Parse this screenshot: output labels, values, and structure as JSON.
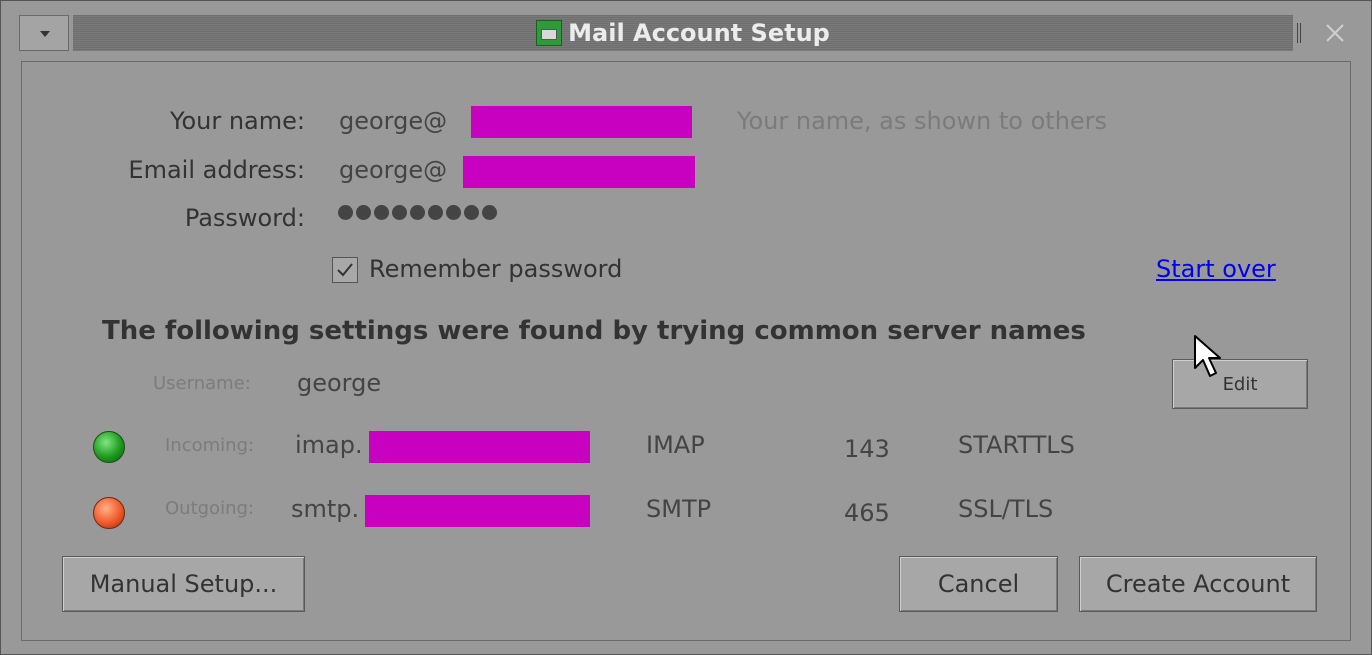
{
  "window": {
    "title": "Mail Account Setup",
    "icon": "mail-app-icon"
  },
  "form": {
    "name_label": "Your name:",
    "name_value": "george@",
    "name_hint": "Your name, as shown to others",
    "email_label": "Email address:",
    "email_value": "george@",
    "password_label": "Password:",
    "password_mask_count": 9,
    "remember_label": "Remember password",
    "remember_checked": true,
    "start_over": "Start over"
  },
  "settings": {
    "heading": "The following settings were found by trying common server names",
    "username_label": "Username:",
    "username_value": "george",
    "incoming_label": "Incoming:",
    "incoming_host": "imap.",
    "incoming_protocol": "IMAP",
    "incoming_port": "143",
    "incoming_security": "STARTTLS",
    "incoming_status": "green",
    "outgoing_label": "Outgoing:",
    "outgoing_host": "smtp.",
    "outgoing_protocol": "SMTP",
    "outgoing_port": "465",
    "outgoing_security": "SSL/TLS",
    "outgoing_status": "orange",
    "edit_button": "Edit"
  },
  "buttons": {
    "manual_setup": "Manual Setup...",
    "cancel": "Cancel",
    "create_account": "Create Account"
  },
  "colors": {
    "window_bg": "#999999",
    "redaction": "#c800c0",
    "link": "#0000ee"
  }
}
